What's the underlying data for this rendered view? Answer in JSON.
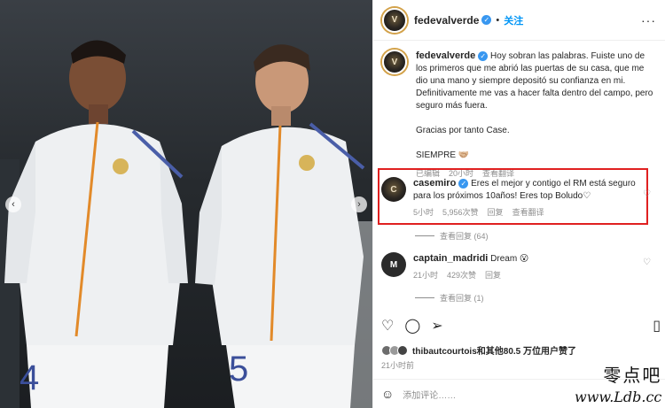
{
  "post": {
    "username": "fedevalverde",
    "follow_label": "关注",
    "caption_lines": [
      "Hoy sobran las palabras. Fuiste uno de los primeros que me abrió las puertas de su casa, que me dio una mano y siempre depositó su confianza en mi.",
      "Definitivamente me vas a hacer falta dentro del campo, pero seguro más fuera.",
      "Gracias por tanto Case.",
      "SIEMPRE 🤝🏼"
    ],
    "caption_meta": {
      "edited": "已编辑",
      "time": "20小时",
      "translate": "查看翻译"
    }
  },
  "comments": [
    {
      "username": "casemiro",
      "text": "Eres el mejor y contigo el RM está seguro para los próximos 10años! Eres top Boludo♡",
      "time": "5小时",
      "likes": "5,956次赞",
      "reply": "回复",
      "translate": "查看翻译",
      "view_replies": "查看回复 (64)"
    },
    {
      "username": "captain_madridi",
      "text": "Dream 😮",
      "time": "21小时",
      "likes": "429次赞",
      "reply": "回复",
      "view_replies": "查看回复 (1)"
    }
  ],
  "likes": {
    "first_user": "thibautcourtois",
    "rest": "和其他80.5 万位用户赞了"
  },
  "posted_time": "21小时前",
  "add_comment_placeholder": "添加评论……",
  "watermark": {
    "line1": "零点吧",
    "line2": "www.Ldb.cc"
  },
  "colors": {
    "accent": "#0095f6",
    "highlight": "#e02020",
    "verified": "#3897f0"
  },
  "icons": {
    "heart": "heart-icon",
    "comment": "comment-icon",
    "share": "paper-plane-icon",
    "save": "bookmark-icon",
    "emoji": "smiley-icon"
  }
}
